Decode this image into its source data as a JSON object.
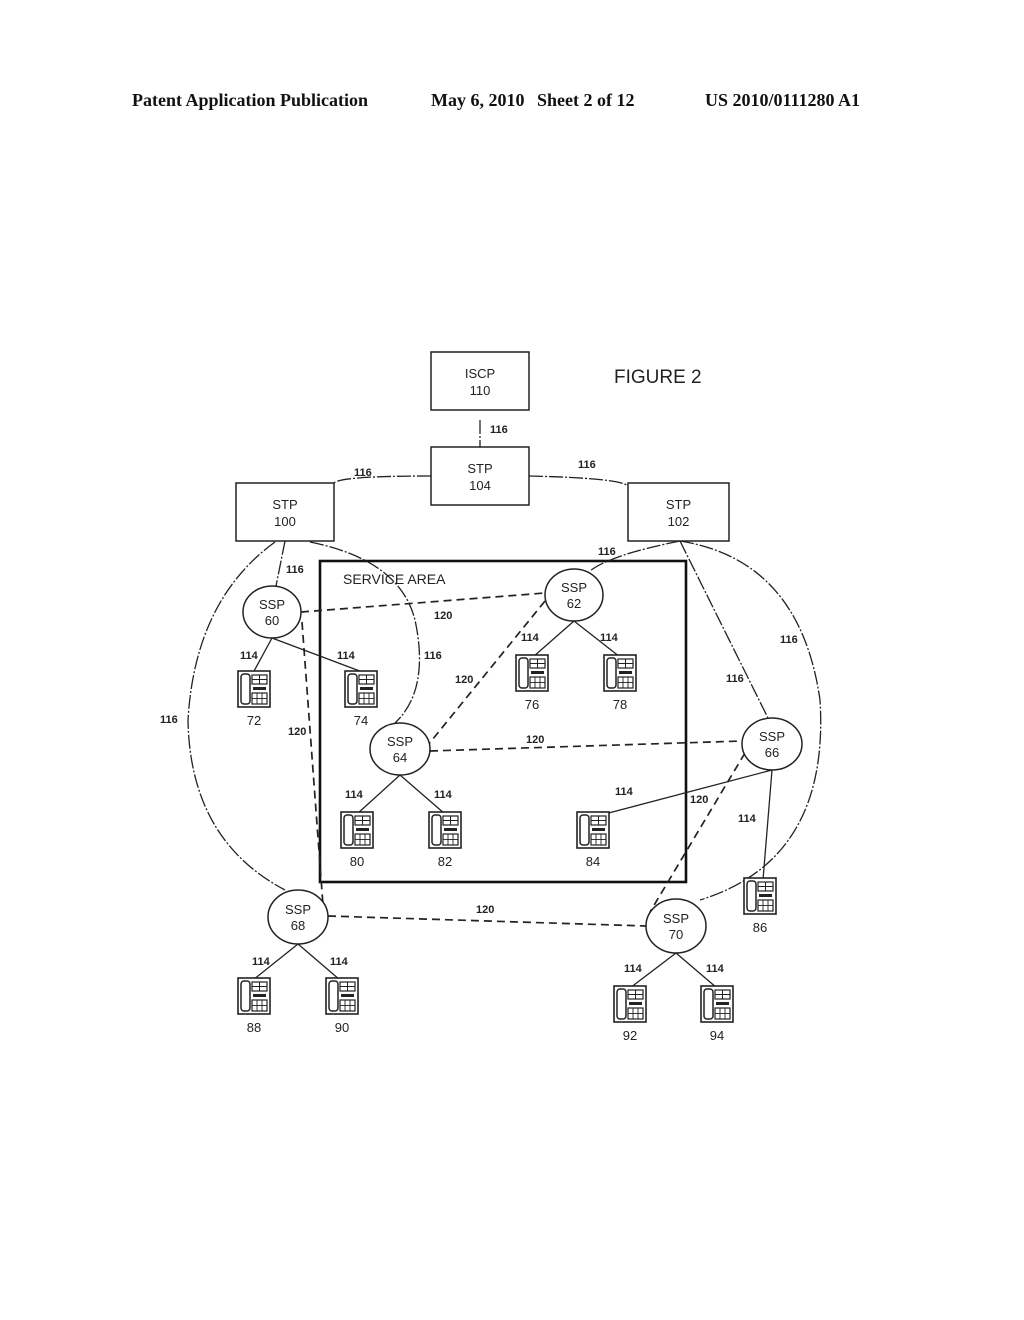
{
  "header": {
    "publication": "Patent Application Publication",
    "date": "May 6, 2010",
    "sheet": "Sheet 2 of 12",
    "number": "US 2010/0111280 A1"
  },
  "figure": {
    "title": "FIGURE 2",
    "service_area_label": "SERVICE AREA",
    "boxes": [
      {
        "id": "iscp110",
        "type": "ISCP",
        "ref": "110"
      },
      {
        "id": "stp104",
        "type": "STP",
        "ref": "104"
      },
      {
        "id": "stp100",
        "type": "STP",
        "ref": "100"
      },
      {
        "id": "stp102",
        "type": "STP",
        "ref": "102"
      }
    ],
    "ssps": [
      {
        "id": "ssp60",
        "type": "SSP",
        "ref": "60"
      },
      {
        "id": "ssp62",
        "type": "SSP",
        "ref": "62"
      },
      {
        "id": "ssp64",
        "type": "SSP",
        "ref": "64"
      },
      {
        "id": "ssp66",
        "type": "SSP",
        "ref": "66"
      },
      {
        "id": "ssp68",
        "type": "SSP",
        "ref": "68"
      },
      {
        "id": "ssp70",
        "type": "SSP",
        "ref": "70"
      }
    ],
    "terminals": [
      {
        "id": "t72",
        "ref": "72",
        "icon": "telephone-icon"
      },
      {
        "id": "t74",
        "ref": "74",
        "icon": "telephone-icon"
      },
      {
        "id": "t76",
        "ref": "76",
        "icon": "telephone-icon"
      },
      {
        "id": "t78",
        "ref": "78",
        "icon": "telephone-icon"
      },
      {
        "id": "t80",
        "ref": "80",
        "icon": "telephone-icon"
      },
      {
        "id": "t82",
        "ref": "82",
        "icon": "telephone-icon"
      },
      {
        "id": "t84",
        "ref": "84",
        "icon": "telephone-icon"
      },
      {
        "id": "t86",
        "ref": "86",
        "icon": "telephone-icon"
      },
      {
        "id": "t88",
        "ref": "88",
        "icon": "telephone-icon"
      },
      {
        "id": "t90",
        "ref": "90",
        "icon": "telephone-icon"
      },
      {
        "id": "t92",
        "ref": "92",
        "icon": "telephone-icon"
      },
      {
        "id": "t94",
        "ref": "94",
        "icon": "telephone-icon"
      }
    ],
    "links": [
      {
        "from": "iscp110",
        "to": "stp104",
        "ref": "116",
        "kind": "signaling"
      },
      {
        "from": "stp104",
        "to": "stp100",
        "ref": "116",
        "kind": "signaling"
      },
      {
        "from": "stp104",
        "to": "stp102",
        "ref": "116",
        "kind": "signaling"
      },
      {
        "from": "stp100",
        "to": "ssp60",
        "ref": "116",
        "kind": "signaling"
      },
      {
        "from": "stp100",
        "to": "ssp64",
        "ref": "116",
        "kind": "signaling"
      },
      {
        "from": "stp100",
        "to": "ssp68",
        "ref": "116",
        "kind": "signaling"
      },
      {
        "from": "stp102",
        "to": "ssp62",
        "ref": "116",
        "kind": "signaling"
      },
      {
        "from": "stp102",
        "to": "ssp66",
        "ref": "116",
        "kind": "signaling"
      },
      {
        "from": "stp102",
        "to": "ssp70",
        "ref": "116",
        "kind": "signaling"
      },
      {
        "from": "ssp60",
        "to": "ssp62",
        "ref": "120",
        "kind": "trunk"
      },
      {
        "from": "ssp60",
        "to": "ssp68",
        "ref": "120",
        "kind": "trunk"
      },
      {
        "from": "ssp62",
        "to": "ssp64",
        "ref": "120",
        "kind": "trunk"
      },
      {
        "from": "ssp64",
        "to": "ssp66",
        "ref": "120",
        "kind": "trunk"
      },
      {
        "from": "ssp66",
        "to": "ssp70",
        "ref": "120",
        "kind": "trunk"
      },
      {
        "from": "ssp68",
        "to": "ssp70",
        "ref": "120",
        "kind": "trunk"
      },
      {
        "from": "ssp60",
        "to": "t72",
        "ref": "114",
        "kind": "line"
      },
      {
        "from": "ssp60",
        "to": "t74",
        "ref": "114",
        "kind": "line"
      },
      {
        "from": "ssp62",
        "to": "t76",
        "ref": "114",
        "kind": "line"
      },
      {
        "from": "ssp62",
        "to": "t78",
        "ref": "114",
        "kind": "line"
      },
      {
        "from": "ssp64",
        "to": "t80",
        "ref": "114",
        "kind": "line"
      },
      {
        "from": "ssp64",
        "to": "t82",
        "ref": "114",
        "kind": "line"
      },
      {
        "from": "ssp66",
        "to": "t84",
        "ref": "114",
        "kind": "line"
      },
      {
        "from": "ssp66",
        "to": "t86",
        "ref": "114",
        "kind": "line"
      },
      {
        "from": "ssp68",
        "to": "t88",
        "ref": "114",
        "kind": "line"
      },
      {
        "from": "ssp68",
        "to": "t90",
        "ref": "114",
        "kind": "line"
      },
      {
        "from": "ssp70",
        "to": "t92",
        "ref": "114",
        "kind": "line"
      },
      {
        "from": "ssp70",
        "to": "t94",
        "ref": "114",
        "kind": "line"
      }
    ]
  }
}
